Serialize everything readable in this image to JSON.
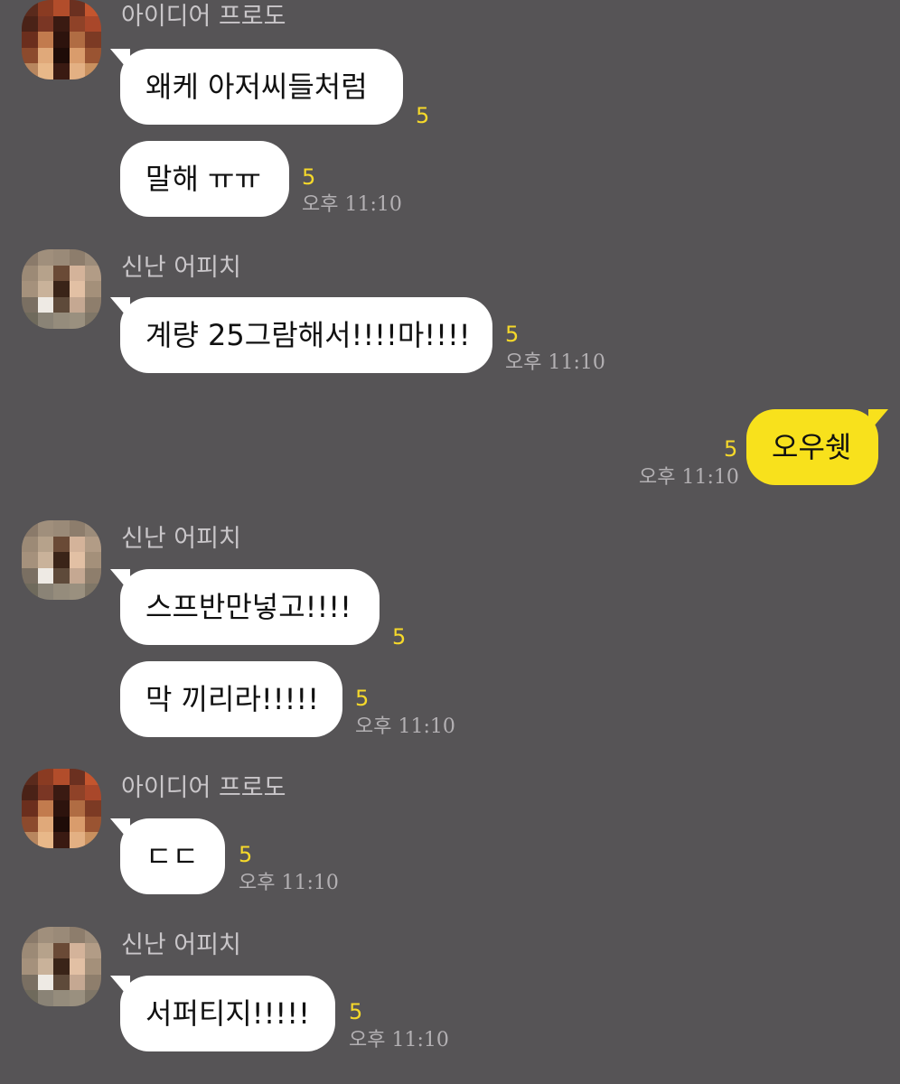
{
  "colors": {
    "background": "#565456",
    "incoming_bubble": "#ffffff",
    "outgoing_bubble": "#f8e11c",
    "unread_count": "#f6d92a",
    "timestamp": "#b3b0b3",
    "sender_name": "#c9c6c9"
  },
  "messages": [
    {
      "sender": "아이디어 프로도",
      "text": "왜케 아저씨들처럼",
      "unread": "5"
    },
    {
      "text": "말해 ㅠㅠ",
      "unread": "5",
      "time": "오후 11:10"
    },
    {
      "sender": "신난 어피치",
      "text": "계량 25그람해서!!!!마!!!!",
      "unread": "5",
      "time": "오후 11:10"
    },
    {
      "text": "오우쉣",
      "unread": "5",
      "time": "오후 11:10",
      "outgoing": true
    },
    {
      "sender": "신난 어피치",
      "text": "스프반만넣고!!!!",
      "unread": "5"
    },
    {
      "text": "막 끼리라!!!!!",
      "unread": "5",
      "time": "오후 11:10"
    },
    {
      "sender": "아이디어 프로도",
      "text": "ㄷㄷ",
      "unread": "5",
      "time": "오후 11:10"
    },
    {
      "sender": "신난 어피치",
      "text": "서퍼티지!!!!!",
      "unread": "5",
      "time": "오후 11:10"
    }
  ]
}
